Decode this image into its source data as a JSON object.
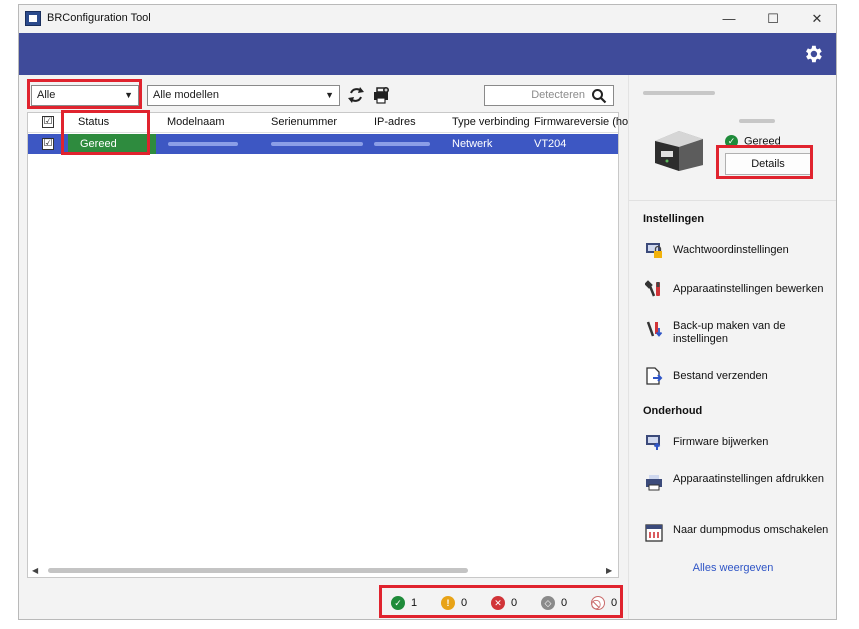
{
  "window": {
    "title": "BRConfiguration Tool",
    "controls": [
      "—",
      "☐",
      "✕"
    ]
  },
  "toolbar": {
    "filter_value": "Alle",
    "model_value": "Alle modellen",
    "search_placeholder": "Detecteren"
  },
  "table": {
    "columns": [
      "Status",
      "Modelnaam",
      "Serienummer",
      "IP-adres",
      "Type verbinding",
      "Firmwareversie (hoo"
    ],
    "rows": [
      {
        "checked": "☑",
        "status": "Gereed",
        "connection": "Netwerk",
        "firmware": "VT204"
      }
    ],
    "header_check": "☑"
  },
  "counters": [
    {
      "icon": "ok-icon",
      "count": "1",
      "color": "#1f8b3a"
    },
    {
      "icon": "warning-icon",
      "count": "0",
      "color": "#e8a317"
    },
    {
      "icon": "error-icon",
      "count": "0",
      "color": "#d13438"
    },
    {
      "icon": "offline-icon",
      "count": "0",
      "color": "#8a8a8a"
    },
    {
      "icon": "disabled-icon",
      "count": "0",
      "color": "#c96a6a"
    }
  ],
  "device": {
    "status": "Gereed",
    "details_label": "Details"
  },
  "settings": {
    "heading": "Instellingen",
    "items": [
      {
        "label": "Wachtwoordinstellingen",
        "icon": "password-settings-icon"
      },
      {
        "label": "Apparaatinstellingen bewerken",
        "icon": "device-settings-icon"
      },
      {
        "label": "Back-up maken van de instellingen",
        "icon": "backup-icon"
      },
      {
        "label": "Bestand verzenden",
        "icon": "send-file-icon"
      }
    ]
  },
  "maintenance": {
    "heading": "Onderhoud",
    "items": [
      {
        "label": "Firmware bijwerken",
        "icon": "firmware-update-icon"
      },
      {
        "label": "Apparaatinstellingen afdrukken",
        "icon": "print-settings-icon"
      },
      {
        "label": "Naar dumpmodus omschakelen",
        "icon": "dump-mode-icon"
      }
    ],
    "show_all": "Alles weergeven"
  },
  "colors": {
    "header": "#3f4b9a",
    "selection": "#3d57c3",
    "ready": "#2e8b3e",
    "highlight": "#e0232e"
  }
}
